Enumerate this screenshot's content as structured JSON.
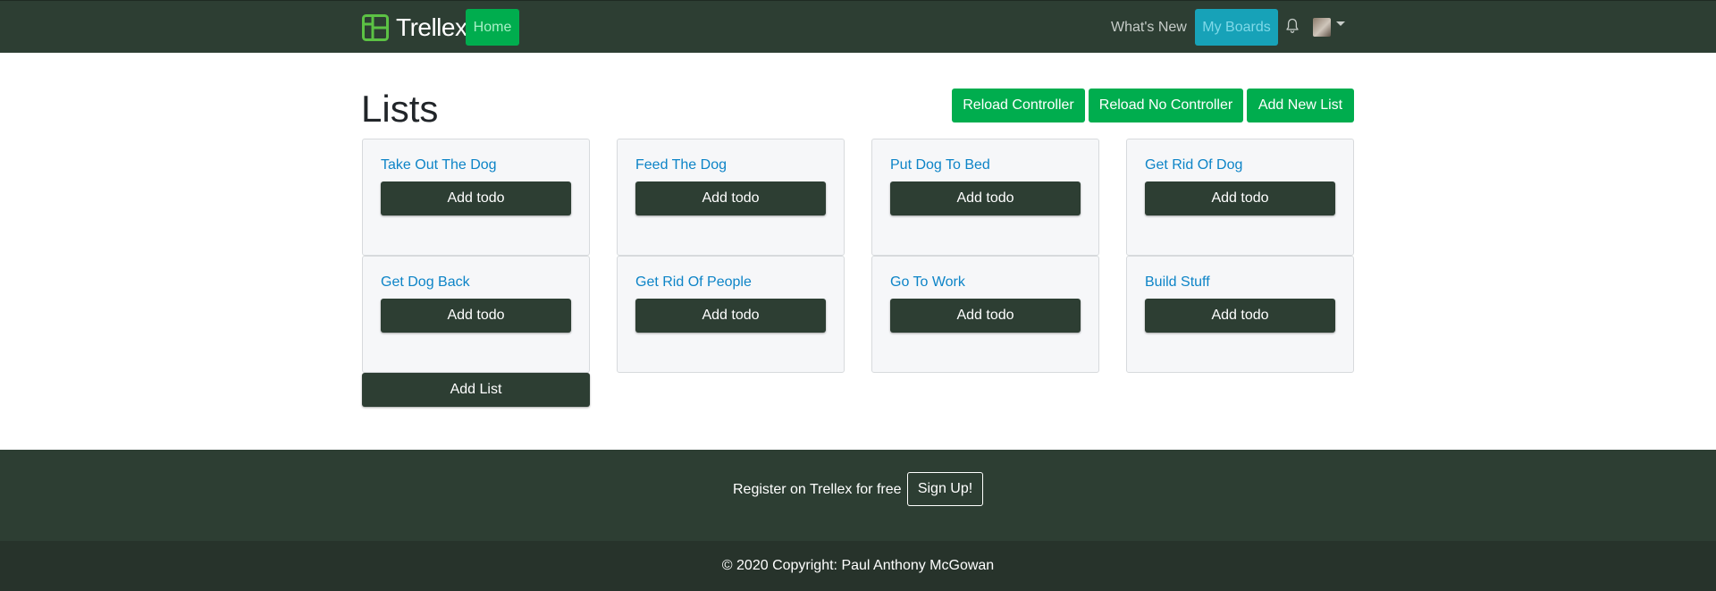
{
  "navbar": {
    "brand": "Trellex",
    "home_label": "Home",
    "whats_new_label": "What's New",
    "my_boards_label": "My Boards"
  },
  "page": {
    "title": "Lists",
    "reload_controller_label": "Reload Controller",
    "reload_no_controller_label": "Reload No Controller",
    "add_new_list_label": "Add New List"
  },
  "lists": [
    {
      "title": "Take Out The Dog",
      "button": "Add todo"
    },
    {
      "title": "Feed The Dog",
      "button": "Add todo"
    },
    {
      "title": "Put Dog To Bed",
      "button": "Add todo"
    },
    {
      "title": "Get Rid Of Dog",
      "button": "Add todo"
    },
    {
      "title": "Get Dog Back",
      "button": "Add todo"
    },
    {
      "title": "Get Rid Of People",
      "button": "Add todo"
    },
    {
      "title": "Go To Work",
      "button": "Add todo"
    },
    {
      "title": "Build Stuff",
      "button": "Add todo"
    }
  ],
  "add_list_label": "Add List",
  "footer": {
    "register_text": "Register on Trellex for free",
    "signup_label": "Sign Up!",
    "copyright": "© 2020 Copyright: Paul Anthony McGowan"
  },
  "icons": {
    "logo": "board-logo-icon",
    "notifications": "bell-icon",
    "user_menu": "chevron-down-icon"
  },
  "colors": {
    "navbar": "#2d3e33",
    "primary_green": "#00ad4e",
    "info_teal": "#17a2b8",
    "link_blue": "#0d84c7",
    "footer_dark": "#27332b"
  }
}
